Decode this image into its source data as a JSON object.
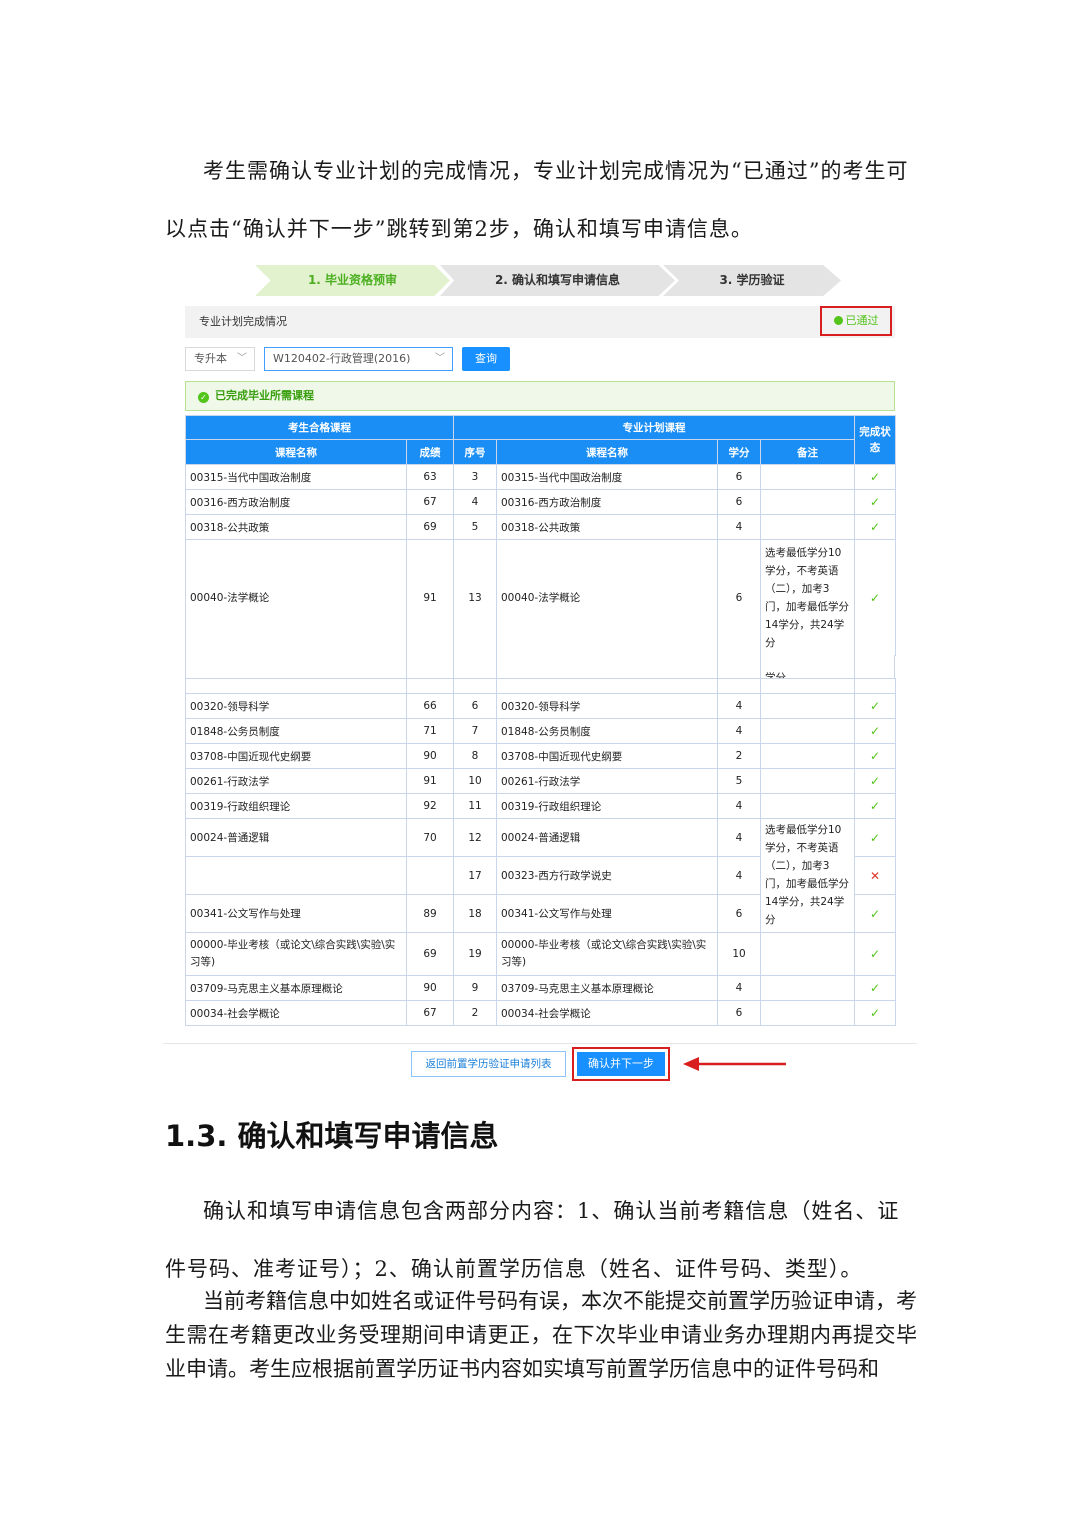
{
  "para1": "考生需确认专业计划的完成情况，专业计划完成情况为“已通过”的考生可以点击“确认并下一步”跳转到第2步，确认和填写申请信息。",
  "steps": [
    "1. 毕业资格预审",
    "2. 确认和填写申请信息",
    "3. 学历验证"
  ],
  "plan_title": "专业计划完成情况",
  "plan_status": "已通过",
  "filters": {
    "level": "专升本",
    "major": "W120402-行政管理(2016)",
    "query_label": "查询"
  },
  "completed_notice": "已完成毕业所需课程",
  "table": {
    "group_left": "考生合格课程",
    "group_right": "专业计划课程",
    "col_done": "完成状态",
    "headers": [
      "课程名称",
      "成绩",
      "序号",
      "课程名称",
      "学分",
      "备注"
    ],
    "note_text": "选考最低学分10学分，不考英语（二），加考3门，加考最低学分14学分，共24学分",
    "note_tail": "学分",
    "rows_top": [
      {
        "course": "00315-当代中国政治制度",
        "score": "63",
        "no": "3",
        "plan": "00315-当代中国政治制度",
        "credit": "6",
        "ok": "✓"
      },
      {
        "course": "00316-西方政治制度",
        "score": "67",
        "no": "4",
        "plan": "00316-西方政治制度",
        "credit": "6",
        "ok": "✓"
      },
      {
        "course": "00318-公共政策",
        "score": "69",
        "no": "5",
        "plan": "00318-公共政策",
        "credit": "4",
        "ok": "✓"
      },
      {
        "course": "00040-法学概论",
        "score": "91",
        "no": "13",
        "plan": "00040-法学概论",
        "credit": "6",
        "ok": "✓"
      }
    ],
    "rows_bottom": [
      {
        "course": "00320-领导科学",
        "score": "66",
        "no": "6",
        "plan": "00320-领导科学",
        "credit": "4",
        "ok": "✓"
      },
      {
        "course": "01848-公务员制度",
        "score": "71",
        "no": "7",
        "plan": "01848-公务员制度",
        "credit": "4",
        "ok": "✓"
      },
      {
        "course": "03708-中国近现代史纲要",
        "score": "90",
        "no": "8",
        "plan": "03708-中国近现代史纲要",
        "credit": "2",
        "ok": "✓"
      },
      {
        "course": "00261-行政法学",
        "score": "91",
        "no": "10",
        "plan": "00261-行政法学",
        "credit": "5",
        "ok": "✓"
      },
      {
        "course": "00319-行政组织理论",
        "score": "92",
        "no": "11",
        "plan": "00319-行政组织理论",
        "credit": "4",
        "ok": "✓"
      }
    ],
    "rows_group": [
      {
        "course": "00024-普通逻辑",
        "score": "70",
        "no": "12",
        "plan": "00024-普通逻辑",
        "credit": "4",
        "ok": "✓"
      },
      {
        "course": "",
        "score": "",
        "no": "17",
        "plan": "00323-西方行政学说史",
        "credit": "4",
        "ok": "✕"
      },
      {
        "course": "00341-公文写作与处理",
        "score": "89",
        "no": "18",
        "plan": "00341-公文写作与处理",
        "credit": "6",
        "ok": "✓"
      }
    ],
    "rows_end": [
      {
        "course": "00000-毕业考核（或论文\\综合实践\\实验\\实习等)",
        "score": "69",
        "no": "19",
        "plan": "00000-毕业考核（或论文\\综合实践\\实验\\实习等)",
        "credit": "10",
        "ok": "✓"
      },
      {
        "course": "03709-马克思主义基本原理概论",
        "score": "90",
        "no": "9",
        "plan": "03709-马克思主义基本原理概论",
        "credit": "4",
        "ok": "✓"
      },
      {
        "course": "00034-社会学概论",
        "score": "67",
        "no": "2",
        "plan": "00034-社会学概论",
        "credit": "6",
        "ok": "✓"
      }
    ]
  },
  "buttons": {
    "back": "返回前置学历验证申请列表",
    "next": "确认并下一步"
  },
  "section_heading": "1.3.  确认和填写申请信息",
  "para2": "确认和填写申请信息包含两部分内容：1、确认当前考籍信息（姓名、证件号码、准考证号）；2、确认前置学历信息（姓名、证件号码、类型）。",
  "para3": "当前考籍信息中如姓名或证件号码有误，本次不能提交前置学历验证申请，考生需在考籍更改业务受理期间申请更正，在下次毕业申请业务办理期内再提交毕业申请。考生应根据前置学历证书内容如实填写前置学历信息中的证件号码和",
  "colors": {
    "primary": "#1890ff",
    "success": "#52c41a",
    "error": "#e0352b",
    "highlight": "#d81e1e"
  }
}
